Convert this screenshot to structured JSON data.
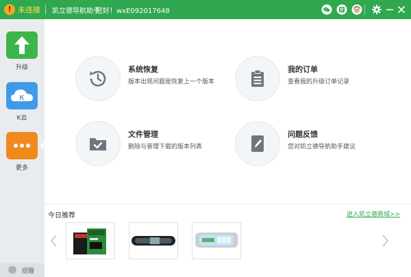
{
  "titlebar": {
    "status": "未连接",
    "app_name": "凯立德导航助手",
    "greeting": "您好！wxE092017648",
    "warn_symbol": "!"
  },
  "sidebar": {
    "items": [
      {
        "label": "升级",
        "icon": "upload-arrow-icon",
        "color": "#3cb54a"
      },
      {
        "label": "K云",
        "icon": "k-cloud-icon",
        "color": "#3f9be6"
      },
      {
        "label": "更多",
        "icon": "more-dots-icon",
        "color": "#f08a1d"
      }
    ],
    "help_label": "提醒"
  },
  "features": [
    {
      "title": "系统恢复",
      "desc": "版本出现问题是恢复上一个版本",
      "icon": "restore-clock-icon"
    },
    {
      "title": "我的订单",
      "desc": "查看我的升级订单记录",
      "icon": "clipboard-icon"
    },
    {
      "title": "文件管理",
      "desc": "删除与管理下载的版本列表",
      "icon": "folder-check-icon"
    },
    {
      "title": "问题反馈",
      "desc": "您对凯立德导航助手建议",
      "icon": "pencil-feedback-icon"
    }
  ],
  "recommend": {
    "title": "今日推荐",
    "link": "进入凯立德商城>>",
    "products": [
      "sd-card-product",
      "mirror-dashcam-product",
      "mirror-dvr-product"
    ]
  },
  "colors": {
    "brand": "#2fa84f",
    "sidebar_bg": "#e9ecef",
    "icon_gray": "#6b7780"
  }
}
